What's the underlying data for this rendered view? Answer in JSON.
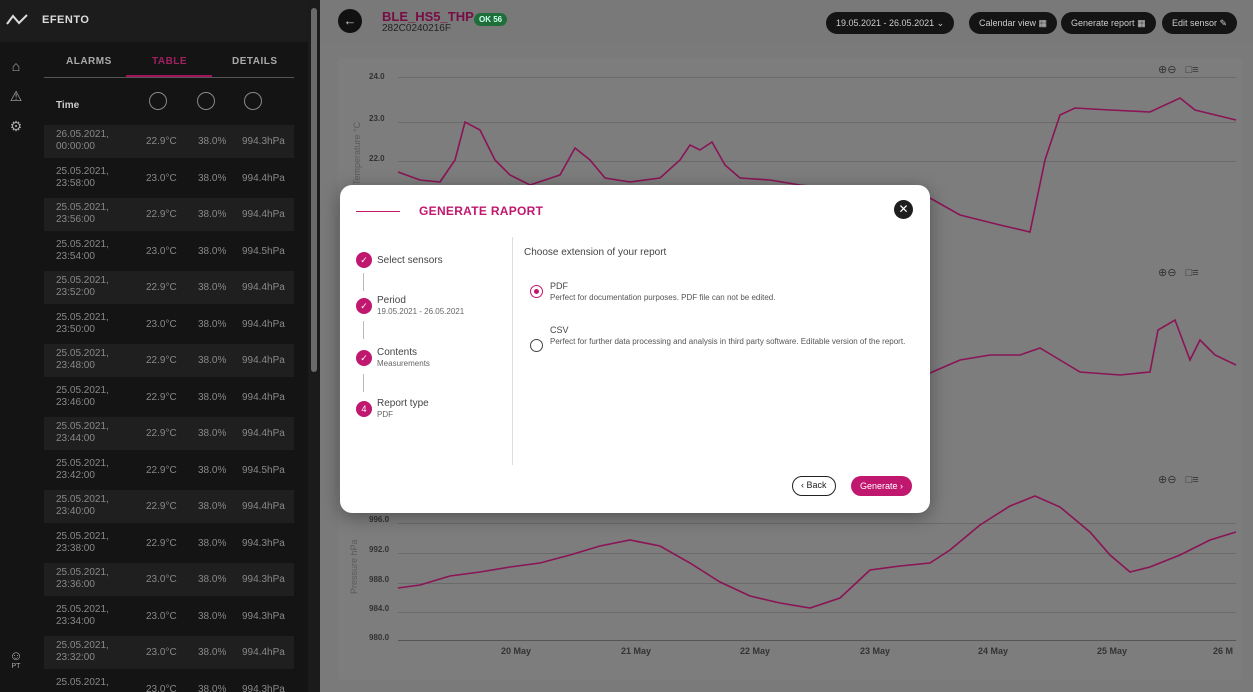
{
  "app": {
    "brand": "EFENTO"
  },
  "sidebar_user": {
    "initials": "PT"
  },
  "tabs": [
    {
      "label": "ALARMS"
    },
    {
      "label": "TABLE"
    },
    {
      "label": "DETAILS"
    }
  ],
  "table": {
    "time_header": "Time",
    "rows": [
      {
        "date": "26.05.2021,",
        "time": "00:00:00",
        "temp": "22.9°C",
        "hum": "38.0%",
        "press": "994.3hPa"
      },
      {
        "date": "25.05.2021,",
        "time": "23:58:00",
        "temp": "23.0°C",
        "hum": "38.0%",
        "press": "994.4hPa"
      },
      {
        "date": "25.05.2021,",
        "time": "23:56:00",
        "temp": "22.9°C",
        "hum": "38.0%",
        "press": "994.4hPa"
      },
      {
        "date": "25.05.2021,",
        "time": "23:54:00",
        "temp": "23.0°C",
        "hum": "38.0%",
        "press": "994.5hPa"
      },
      {
        "date": "25.05.2021,",
        "time": "23:52:00",
        "temp": "22.9°C",
        "hum": "38.0%",
        "press": "994.4hPa"
      },
      {
        "date": "25.05.2021,",
        "time": "23:50:00",
        "temp": "23.0°C",
        "hum": "38.0%",
        "press": "994.4hPa"
      },
      {
        "date": "25.05.2021,",
        "time": "23:48:00",
        "temp": "22.9°C",
        "hum": "38.0%",
        "press": "994.4hPa"
      },
      {
        "date": "25.05.2021,",
        "time": "23:46:00",
        "temp": "22.9°C",
        "hum": "38.0%",
        "press": "994.4hPa"
      },
      {
        "date": "25.05.2021,",
        "time": "23:44:00",
        "temp": "22.9°C",
        "hum": "38.0%",
        "press": "994.4hPa"
      },
      {
        "date": "25.05.2021,",
        "time": "23:42:00",
        "temp": "22.9°C",
        "hum": "38.0%",
        "press": "994.5hPa"
      },
      {
        "date": "25.05.2021,",
        "time": "23:40:00",
        "temp": "22.9°C",
        "hum": "38.0%",
        "press": "994.4hPa"
      },
      {
        "date": "25.05.2021,",
        "time": "23:38:00",
        "temp": "22.9°C",
        "hum": "38.0%",
        "press": "994.3hPa"
      },
      {
        "date": "25.05.2021,",
        "time": "23:36:00",
        "temp": "23.0°C",
        "hum": "38.0%",
        "press": "994.3hPa"
      },
      {
        "date": "25.05.2021,",
        "time": "23:34:00",
        "temp": "23.0°C",
        "hum": "38.0%",
        "press": "994.3hPa"
      },
      {
        "date": "25.05.2021,",
        "time": "23:32:00",
        "temp": "23.0°C",
        "hum": "38.0%",
        "press": "994.4hPa"
      },
      {
        "date": "25.05.2021,",
        "time": "",
        "temp": "23.0°C",
        "hum": "38.0%",
        "press": "994.3hPa"
      }
    ]
  },
  "header": {
    "sensor_name": "BLE_HS5_THP",
    "sensor_id": "282C0240216F",
    "status_badge": "OK",
    "status_count": "56",
    "date_range": "19.05.2021 - 26.05.2021",
    "calendar_view": "Calendar view",
    "generate_report": "Generate report",
    "edit_sensor": "Edit sensor"
  },
  "charts": {
    "temperature": {
      "ylabel": "Temperature °C",
      "yticks": [
        "24.0",
        "23.0",
        "22.0"
      ]
    },
    "pressure": {
      "ylabel": "Pressure hPa",
      "yticks": [
        "996.0",
        "992.0",
        "988.0",
        "984.0",
        "980.0"
      ]
    },
    "xticks": [
      "20 May",
      "21 May",
      "22 May",
      "23 May",
      "24 May",
      "25 May",
      "26 M"
    ]
  },
  "modal": {
    "title": "GENERATE RAPORT",
    "steps": [
      {
        "label": "Select sensors",
        "sub": ""
      },
      {
        "label": "Period",
        "sub": "19.05.2021 - 26.05.2021"
      },
      {
        "label": "Contents",
        "sub": "Measurements"
      },
      {
        "label": "Report type",
        "sub": "PDF",
        "number": "4"
      }
    ],
    "choose_label": "Choose extension of your report",
    "options": [
      {
        "name": "PDF",
        "desc": "Perfect for documentation purposes. PDF file can not be edited.",
        "selected": true
      },
      {
        "name": "CSV",
        "desc": "Perfect for further data processing and analysis in third party software. Editable version of the report.",
        "selected": false
      }
    ],
    "back_label": "‹ Back",
    "generate_label": "Generate ›"
  },
  "colors": {
    "accent": "#c0176f",
    "series": "#8a1456"
  }
}
